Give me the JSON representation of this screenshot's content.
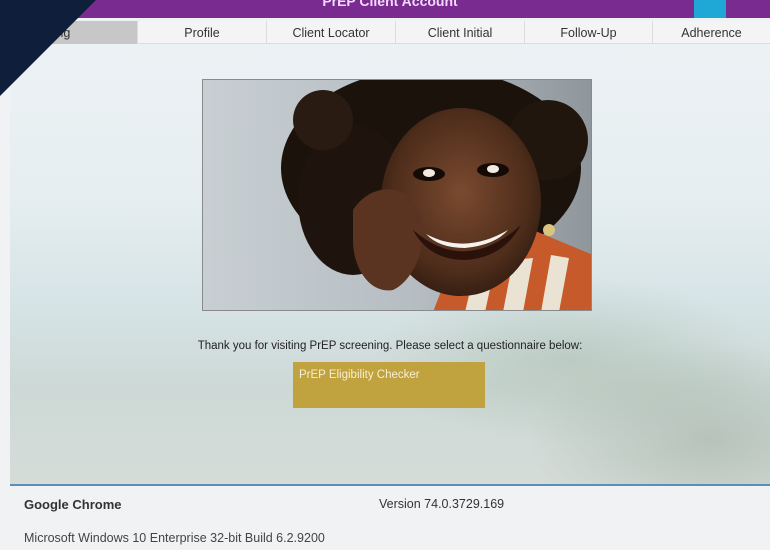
{
  "header": {
    "title": "PrEP Client Account"
  },
  "tabs": [
    {
      "label": "Screening",
      "active": true
    },
    {
      "label": "Profile",
      "active": false
    },
    {
      "label": "Client Locator",
      "active": false
    },
    {
      "label": "Client Initial",
      "active": false
    },
    {
      "label": "Follow-Up",
      "active": false
    },
    {
      "label": "Adherence",
      "active": false
    }
  ],
  "main": {
    "intro_text": "Thank you for visiting PrEP screening. Please select a questionnaire below:",
    "questionnaire_button": "PrEP Eligibility Checker"
  },
  "system_info": {
    "browser": "Google Chrome",
    "version": "Version 74.0.3729.169",
    "os": "Microsoft Windows 10 Enterprise 32-bit Build 6.2.9200"
  },
  "colors": {
    "header_purple": "#7a2b8f",
    "accent_blue": "#1fa7d6",
    "button_gold": "#c0a23e",
    "corner_navy": "#0f1f3b"
  }
}
